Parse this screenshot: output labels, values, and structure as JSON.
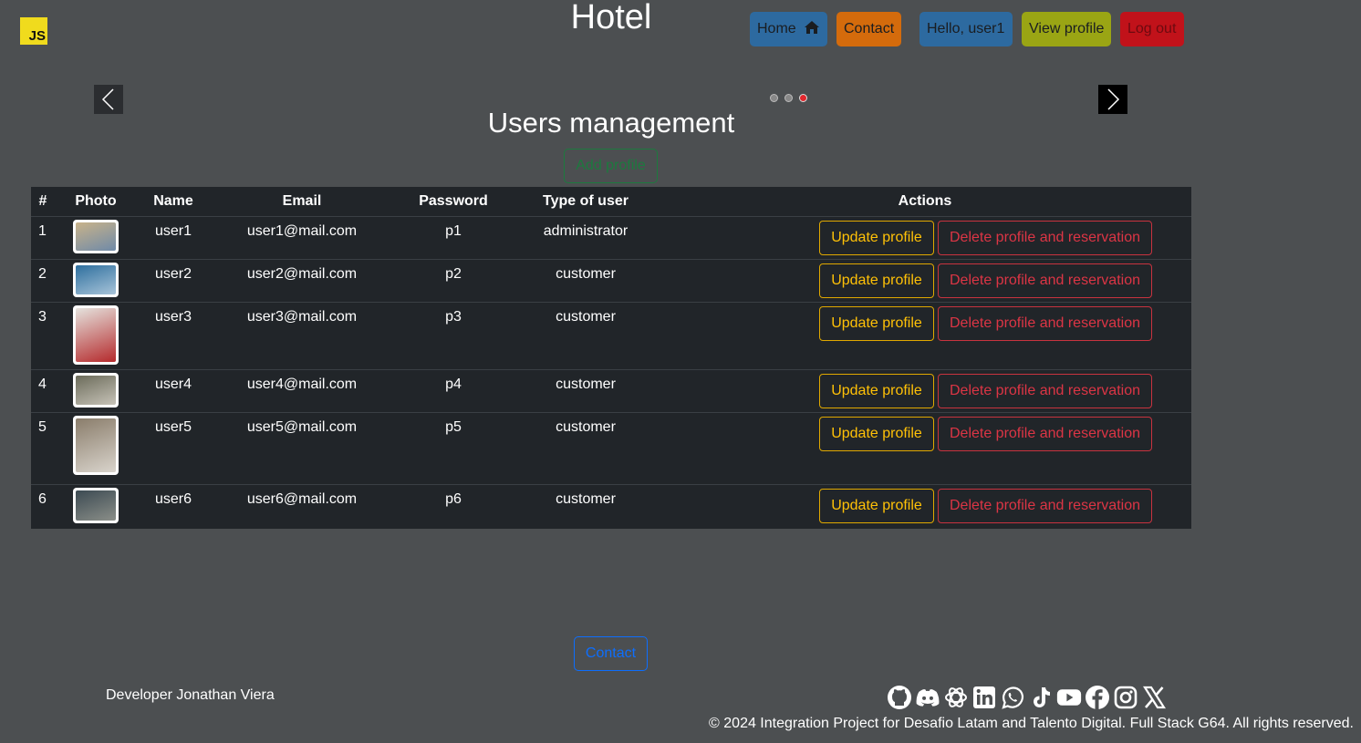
{
  "header": {
    "logo_text": "JS",
    "site_title": "Hotel",
    "nav": {
      "home": "Home",
      "contact": "Contact",
      "hello": "Hello, user1",
      "view_profile": "View profile",
      "logout": "Log out"
    }
  },
  "carousel": {
    "slides": 3,
    "active_slide": 3,
    "prev_icon": "chevron-left-icon",
    "next_icon": "chevron-right-icon"
  },
  "main": {
    "title": "Users management",
    "add_profile": "Add profile",
    "table": {
      "headers": [
        "#",
        "Photo",
        "Name",
        "Email",
        "Password",
        "Type of user",
        "Actions"
      ],
      "rows": [
        {
          "num": "1",
          "name": "user1",
          "email": "user1@mail.com",
          "password": "p1",
          "type": "administrator",
          "update": "Update profile",
          "delete": "Delete profile and reservation"
        },
        {
          "num": "2",
          "name": "user2",
          "email": "user2@mail.com",
          "password": "p2",
          "type": "customer",
          "update": "Update profile",
          "delete": "Delete profile and reservation"
        },
        {
          "num": "3",
          "name": "user3",
          "email": "user3@mail.com",
          "password": "p3",
          "type": "customer",
          "update": "Update profile",
          "delete": "Delete profile and reservation"
        },
        {
          "num": "4",
          "name": "user4",
          "email": "user4@mail.com",
          "password": "p4",
          "type": "customer",
          "update": "Update profile",
          "delete": "Delete profile and reservation"
        },
        {
          "num": "5",
          "name": "user5",
          "email": "user5@mail.com",
          "password": "p5",
          "type": "customer",
          "update": "Update profile",
          "delete": "Delete profile and reservation"
        },
        {
          "num": "6",
          "name": "user6",
          "email": "user6@mail.com",
          "password": "p6",
          "type": "customer",
          "update": "Update profile",
          "delete": "Delete profile and reservation"
        }
      ]
    }
  },
  "footer": {
    "contact": "Contact",
    "developer": "Developer Jonathan Viera",
    "socials": [
      "github-icon",
      "discord-icon",
      "openai-icon",
      "linkedin-icon",
      "whatsapp-icon",
      "tiktok-icon",
      "youtube-icon",
      "facebook-icon",
      "instagram-icon",
      "x-icon"
    ],
    "copyright": "© 2024 Integration Project for Desafio Latam and Talento Digital. Full Stack G64. All rights reserved."
  },
  "colors": {
    "background": "#4c4f51",
    "table": "#212529",
    "home": "#2d6aa0",
    "contact": "#d46b0c",
    "view_profile": "#9aa514",
    "logout": "#c1121a",
    "warning": "#ffc107",
    "danger": "#dc3545",
    "success": "#1c7a3e",
    "primary": "#0d6efd"
  }
}
